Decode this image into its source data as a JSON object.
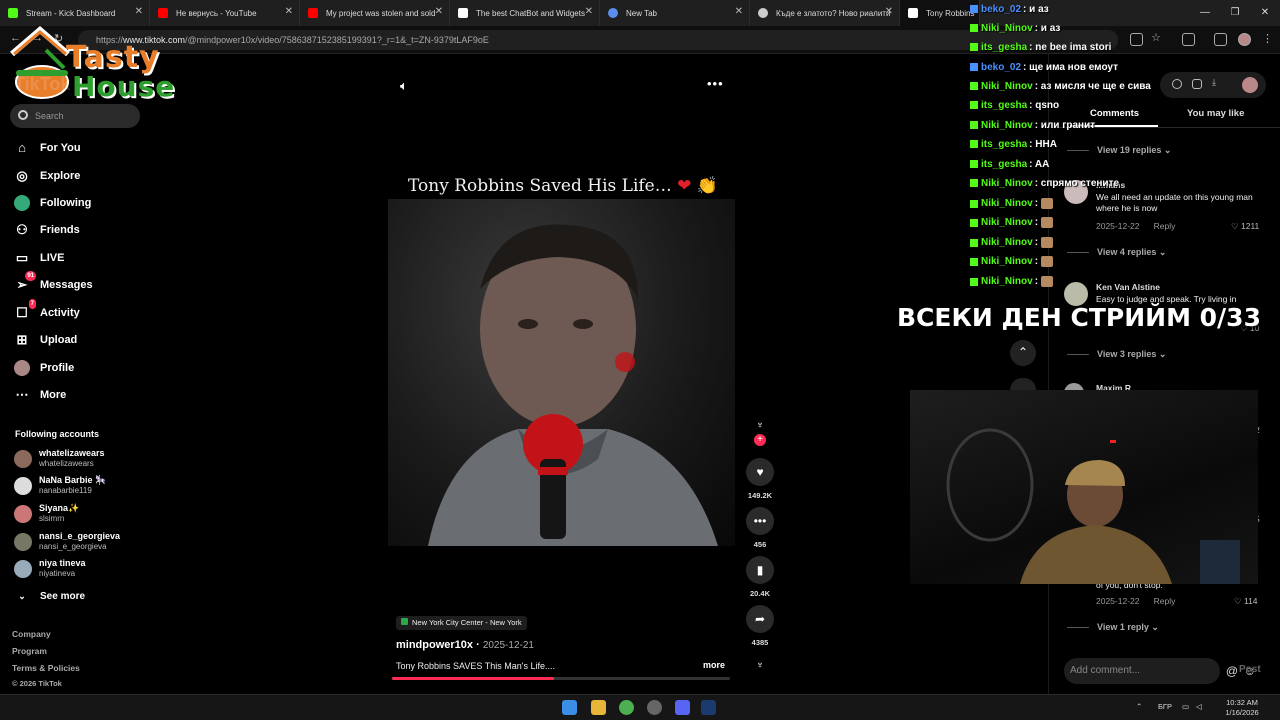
{
  "browser": {
    "tabs": [
      {
        "title": "Stream - Kick Dashboard",
        "color": "#53fc18"
      },
      {
        "title": "Не вернусь - YouTube",
        "color": "#ff0000"
      },
      {
        "title": "My project was stolen and sold",
        "color": "#ff0000"
      },
      {
        "title": "The best ChatBot and Widgets",
        "color": "#ffffff"
      },
      {
        "title": "New Tab",
        "color": "#5b8def"
      },
      {
        "title": "Къде е златото? Ново риалити",
        "color": "#cccccc"
      },
      {
        "title": "Tony Robbins",
        "color": "#ffffff"
      }
    ],
    "url_prefix": "https://",
    "url_domain": "www.tiktok.com",
    "url_path": "/@mindpower10x/video/7586387152385199391?_r=1&_t=ZN-9379tLAF9oE"
  },
  "logo": {
    "line1": "Tasty",
    "line2": "House"
  },
  "sidebar": {
    "brand": "TikTok",
    "search_placeholder": "Search",
    "nav": [
      {
        "label": "For You",
        "icon": "home-icon"
      },
      {
        "label": "Explore",
        "icon": "compass-icon"
      },
      {
        "label": "Following",
        "icon": "following-icon"
      },
      {
        "label": "Friends",
        "icon": "friends-icon"
      },
      {
        "label": "LIVE",
        "icon": "live-icon"
      },
      {
        "label": "Messages",
        "icon": "messages-icon",
        "badge": "91"
      },
      {
        "label": "Activity",
        "icon": "activity-icon",
        "badge": "7"
      },
      {
        "label": "Upload",
        "icon": "upload-icon"
      },
      {
        "label": "Profile",
        "icon": "profile-icon"
      },
      {
        "label": "More",
        "icon": "more-icon"
      }
    ],
    "following_header": "Following accounts",
    "accounts": [
      {
        "name": "whatelizawears",
        "handle": "whatelizawears"
      },
      {
        "name": "NaNa Barbie 🎠",
        "handle": "nanabarbie119"
      },
      {
        "name": "Siyana✨",
        "handle": "slsimrn"
      },
      {
        "name": "nansi_e_georgieva",
        "handle": "nansi_e_georgieva"
      },
      {
        "name": "niya tineva",
        "handle": "niyatineva"
      }
    ],
    "see_more": "See more",
    "footer": [
      "Company",
      "Program",
      "Terms & Policies",
      "© 2026 TikTok"
    ]
  },
  "video": {
    "title": "Tony Robbins Saved His Life…",
    "location": "New York City Center - New York",
    "author": "mindpower10x",
    "date": "2025-12-21",
    "description": "Tony Robbins SAVES This Man's Life....",
    "more_label": "more",
    "progress": 0.48,
    "counts": {
      "likes": "149.2K",
      "comments": "456",
      "saves": "20.4K",
      "shares": "4385"
    }
  },
  "comments_panel": {
    "tab_comments": "Comments",
    "tab_you_may_like": "You may like",
    "view_replies": [
      "View 19 replies",
      "View 4 replies",
      "View 3 replies",
      "View 1 reply"
    ],
    "comment1": {
      "name": "...mans",
      "text": "We all need an update on this young man where he is now",
      "date": "2025-12-22",
      "reply": "Reply",
      "likes": "1211"
    },
    "comment2": {
      "name": "Ken Van Alstine",
      "text": "Easy to judge and speak. Try living in",
      "likes": "10"
    },
    "comment3": {
      "name": "Maxim R"
    },
    "comment4": {
      "text": "of you, don't stop.\"",
      "date": "2025-12-22",
      "reply": "Reply",
      "likes": "114"
    },
    "side_numbers": [
      "2",
      "5"
    ],
    "add_comment": "Add comment...",
    "post": "Post"
  },
  "chat": [
    {
      "user": "beko_02",
      "msg": "и аз",
      "color": "#4a90ff"
    },
    {
      "user": "Niki_Ninov",
      "msg": "и аз",
      "color": "#53fc18"
    },
    {
      "user": "its_gesha",
      "msg": "ne bee ima stori",
      "color": "#53fc18"
    },
    {
      "user": "beko_02",
      "msg": "ще има нов емоут",
      "color": "#4a90ff"
    },
    {
      "user": "Niki_Ninov",
      "msg": "аз мисля че ще е сива",
      "color": "#53fc18"
    },
    {
      "user": "its_gesha",
      "msg": "qsno",
      "color": "#53fc18"
    },
    {
      "user": "Niki_Ninov",
      "msg": "или гранит",
      "color": "#53fc18"
    },
    {
      "user": "its_gesha",
      "msg": "HHA",
      "color": "#53fc18"
    },
    {
      "user": "its_gesha",
      "msg": "AA",
      "color": "#53fc18"
    },
    {
      "user": "Niki_Ninov",
      "msg": "спрямо стените",
      "color": "#53fc18"
    },
    {
      "user": "Niki_Ninov",
      "msg": "",
      "color": "#53fc18"
    },
    {
      "user": "Niki_Ninov",
      "msg": "",
      "color": "#53fc18"
    },
    {
      "user": "Niki_Ninov",
      "msg": "",
      "color": "#53fc18"
    },
    {
      "user": "Niki_Ninov",
      "msg": "",
      "color": "#53fc18"
    },
    {
      "user": "Niki_Ninov",
      "msg": "",
      "color": "#53fc18"
    }
  ],
  "stream_overlay_text": "ВСЕКИ ДЕН СТРИЙМ 0/33",
  "taskbar": {
    "lang": "БГР",
    "time": "10:32 AM",
    "date": "1/16/2026"
  }
}
